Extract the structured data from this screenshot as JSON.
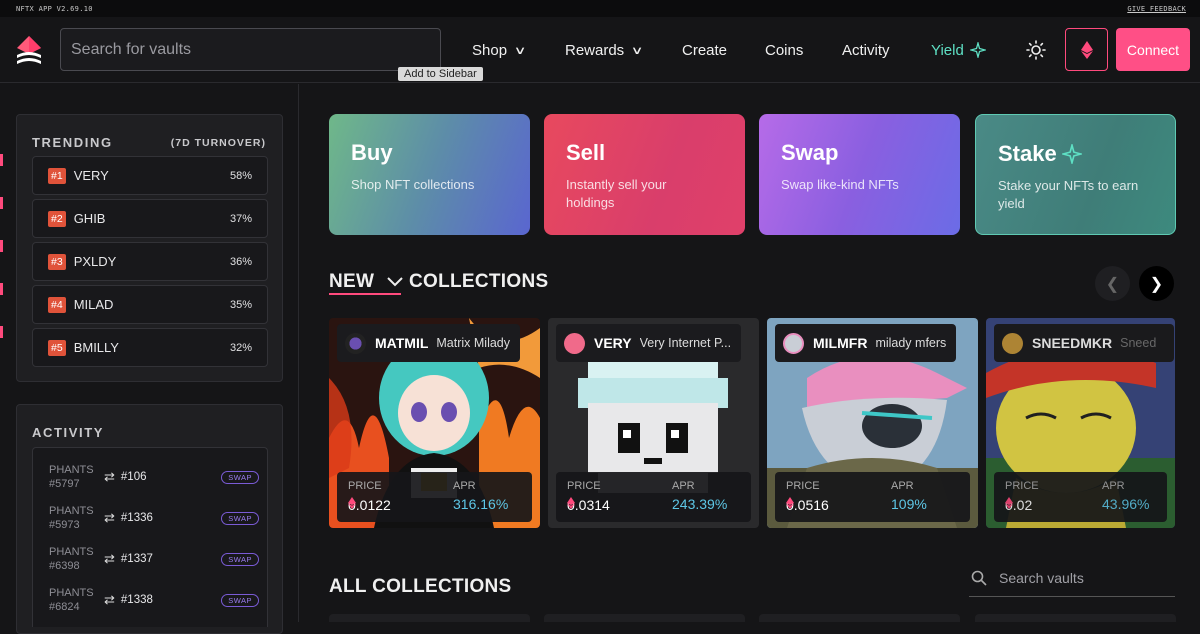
{
  "topbar": {
    "app_version": "NFTX APP V2.69.10",
    "feedback": "GIVE FEEDBACK"
  },
  "header": {
    "search_placeholder": "Search for vaults",
    "tooltip": "Add to Sidebar",
    "nav": {
      "shop": "Shop",
      "rewards": "Rewards",
      "create": "Create",
      "coins": "Coins",
      "activity": "Activity",
      "yield": "Yield"
    },
    "connect_label": "Connect",
    "accent_color": "#ff4f86"
  },
  "trending": {
    "title": "TRENDING",
    "subtitle": "(7D TURNOVER)",
    "items": [
      {
        "rank": "#1",
        "name": "VERY",
        "pct": "58%"
      },
      {
        "rank": "#2",
        "name": "GHIB",
        "pct": "37%"
      },
      {
        "rank": "#3",
        "name": "PXLDY",
        "pct": "36%"
      },
      {
        "rank": "#4",
        "name": "MILAD",
        "pct": "35%"
      },
      {
        "rank": "#5",
        "name": "BMILLY",
        "pct": "32%"
      }
    ]
  },
  "activity": {
    "title": "ACTIVITY",
    "items": [
      {
        "line1": "PHANTS",
        "line2": "#5797",
        "token": "#106",
        "badge": "SWAP"
      },
      {
        "line1": "PHANTS",
        "line2": "#5973",
        "token": "#1336",
        "badge": "SWAP"
      },
      {
        "line1": "PHANTS",
        "line2": "#6398",
        "token": "#1337",
        "badge": "SWAP"
      },
      {
        "line1": "PHANTS",
        "line2": "#6824",
        "token": "#1338",
        "badge": "SWAP"
      }
    ]
  },
  "actions": {
    "buy": {
      "title": "Buy",
      "desc": "Shop NFT collections"
    },
    "sell": {
      "title": "Sell",
      "desc": "Instantly sell your holdings"
    },
    "swap": {
      "title": "Swap",
      "desc": "Swap like-kind NFTs"
    },
    "stake": {
      "title": "Stake",
      "desc": "Stake your NFTs to earn yield"
    }
  },
  "new_collections": {
    "filter": "NEW",
    "title": "COLLECTIONS",
    "items": [
      {
        "symbol": "MATMIL",
        "name": "Matrix Milady",
        "price_label": "PRICE",
        "price": "0.0122",
        "apr_label": "APR",
        "apr": "316.16%"
      },
      {
        "symbol": "VERY",
        "name": "Very Internet P...",
        "price_label": "PRICE",
        "price": "0.0314",
        "apr_label": "APR",
        "apr": "243.39%"
      },
      {
        "symbol": "MILMFR",
        "name": "milady mfers",
        "price_label": "PRICE",
        "price": "0.0516",
        "apr_label": "APR",
        "apr": "109%"
      },
      {
        "symbol": "SNEEDMKR",
        "name": "Sneed",
        "price_label": "PRICE",
        "price": "0.02",
        "apr_label": "APR",
        "apr": "43.96%"
      }
    ]
  },
  "all_collections": {
    "title": "ALL COLLECTIONS",
    "search_placeholder": "Search vaults"
  }
}
